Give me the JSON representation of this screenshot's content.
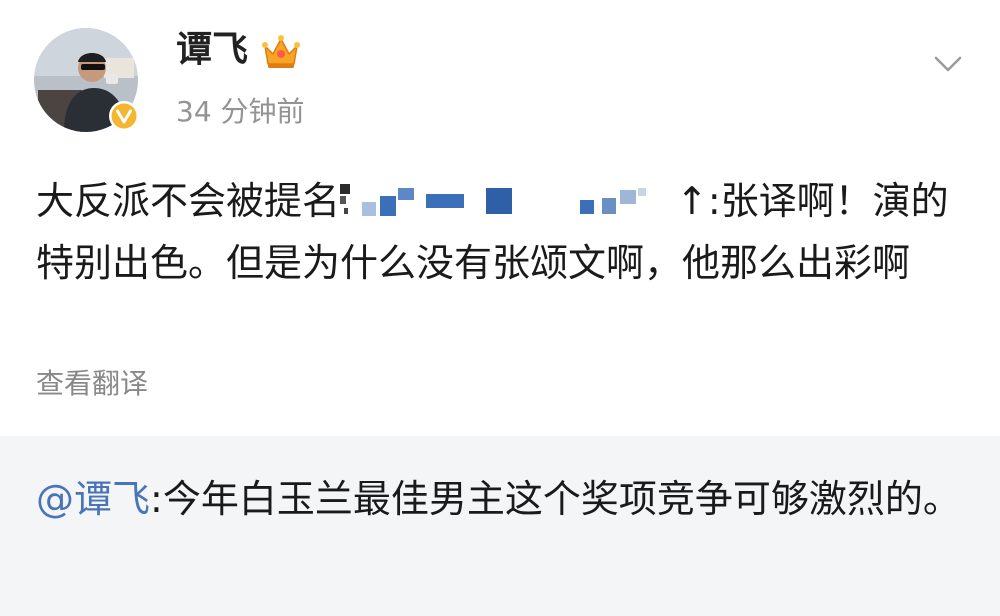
{
  "post": {
    "username": "谭飞",
    "timestamp": "34 分钟前",
    "text_start": "大反派不会被提名",
    "text_after_redaction": "↑:张译啊！演的特别出色。但是为什么没有张颂文啊，他那么出彩啊",
    "translate_label": "查看翻译"
  },
  "quote": {
    "mention": "@谭飞",
    "text": ":今年白玉兰最佳男主这个奖项竞争可够激烈的。"
  },
  "colors": {
    "mention": "#4a74b8",
    "quote_bg": "#f4f5f7",
    "verified": "#f5b52e",
    "redaction": "#3b6fb8"
  },
  "icons": {
    "verified": "verified-v-badge-icon",
    "crown": "crown-icon",
    "more": "chevron-down-icon"
  }
}
